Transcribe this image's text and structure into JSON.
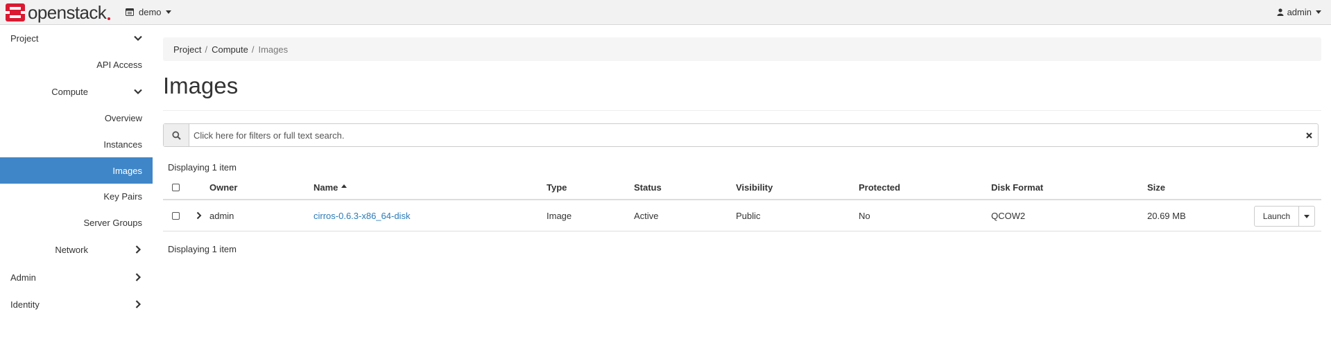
{
  "brand": {
    "name": "openstack"
  },
  "header": {
    "project": "demo",
    "user": "admin"
  },
  "sidebar": {
    "project": "Project",
    "api_access": "API Access",
    "compute": "Compute",
    "overview": "Overview",
    "instances": "Instances",
    "images": "Images",
    "key_pairs": "Key Pairs",
    "server_groups": "Server Groups",
    "network": "Network",
    "admin": "Admin",
    "identity": "Identity"
  },
  "breadcrumb": {
    "project": "Project",
    "compute": "Compute",
    "images": "Images",
    "separator": "/"
  },
  "page": {
    "title": "Images"
  },
  "search": {
    "placeholder": "Click here for filters or full text search."
  },
  "table": {
    "count_label": "Displaying 1 item",
    "headers": {
      "owner": "Owner",
      "name": "Name",
      "type": "Type",
      "status": "Status",
      "visibility": "Visibility",
      "protected": "Protected",
      "disk_format": "Disk Format",
      "size": "Size"
    },
    "rows": [
      {
        "owner": "admin",
        "name": "cirros-0.6.3-x86_64-disk",
        "type": "Image",
        "status": "Active",
        "visibility": "Public",
        "protected": "No",
        "disk_format": "QCOW2",
        "size": "20.69 MB",
        "action": "Launch"
      }
    ]
  },
  "colors": {
    "active_nav": "#3f86c8",
    "link": "#2a7ab9",
    "brand_red": "#da1a32"
  }
}
